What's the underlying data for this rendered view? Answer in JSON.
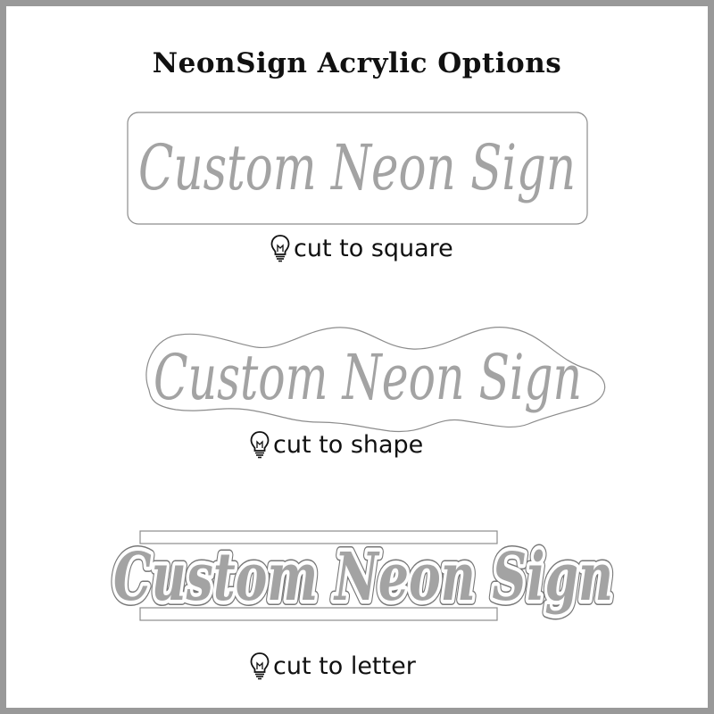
{
  "title": "NeonSign Acrylic Options",
  "sign_text": "Custom Neon Sign",
  "options": [
    {
      "caption": "cut to square",
      "icon": "lightbulb-icon"
    },
    {
      "caption": "cut to shape",
      "icon": "lightbulb-icon"
    },
    {
      "caption": "cut to letter",
      "icon": "lightbulb-icon"
    }
  ],
  "colors": {
    "frame": "#999999",
    "sign_text": "#a3a3a3",
    "outline": "#8c8c8c",
    "title": "#111111"
  }
}
